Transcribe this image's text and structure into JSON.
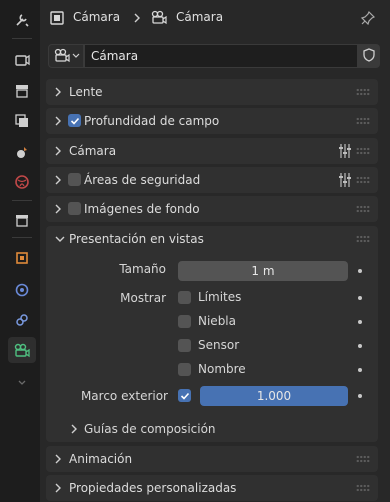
{
  "header": {
    "breadcrumb_object": "Cámara",
    "breadcrumb_data": "Cámara"
  },
  "datablock": {
    "name": "Cámara"
  },
  "panels": {
    "lente": "Lente",
    "profundidad": "Profundidad de campo",
    "camara": "Cámara",
    "areas": "Áreas de seguridad",
    "imagenes": "Imágenes de fondo",
    "presentacion": "Presentación en vistas",
    "animacion": "Animación",
    "propiedades": "Propiedades personalizadas"
  },
  "viewport_display": {
    "size_label": "Tamaño",
    "size_value": "1 m",
    "show_label": "Mostrar",
    "show_options": [
      "Límites",
      "Niebla",
      "Sensor",
      "Nombre"
    ],
    "passepartout_label": "Marco exterior",
    "passepartout_value": "1.000",
    "guides_label": "Guías de composición"
  },
  "colors": {
    "accent": "#4772b3",
    "panel": "#303030",
    "background": "#282828"
  },
  "icons": {
    "tabs": [
      "tool-icon",
      "render-icon",
      "output-icon",
      "view-layer-icon",
      "scene-icon",
      "world-icon",
      "collection-icon",
      "object-icon",
      "physics-icon",
      "constraint-icon",
      "camera-data-icon"
    ]
  }
}
